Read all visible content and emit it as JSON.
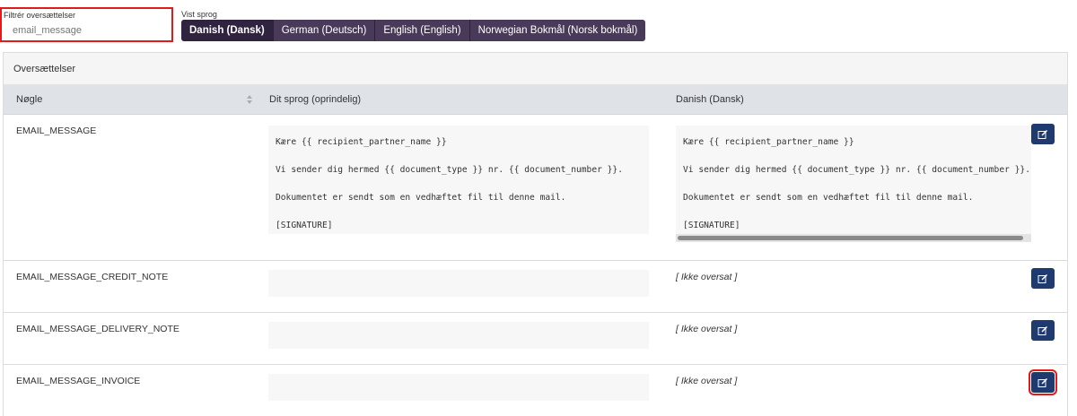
{
  "filter": {
    "label": "Filtrér oversættelser",
    "placeholder": "email_message"
  },
  "languages": {
    "label": "Vist sprog",
    "options": [
      "Danish (Dansk)",
      "German (Deutsch)",
      "English (English)",
      "Norwegian Bokmål (Norsk bokmål)"
    ],
    "active": "Danish (Dansk)"
  },
  "panel": {
    "title": "Oversættelser",
    "columns": [
      "Nøgle",
      "Dit sprog (oprindelig)",
      "Danish (Dansk)"
    ]
  },
  "rows": [
    {
      "key": "EMAIL_MESSAGE",
      "original": [
        "Kære {{ recipient_partner_name }}",
        "Vi sender dig hermed {{ document_type }} nr. {{ document_number }}.",
        "Dokumentet er sendt som en vedhæftet fil til denne mail.",
        "[SIGNATURE]"
      ],
      "translation": [
        "Kære {{ recipient_partner_name }}",
        "Vi sender dig hermed {{ document_type }} nr. {{ document_number }}.",
        "Dokumentet er sendt som en vedhæftet fil til denne mail.",
        "[SIGNATURE]"
      ]
    },
    {
      "key": "EMAIL_MESSAGE_CREDIT_NOTE",
      "translation_text": "[ Ikke oversat ]"
    },
    {
      "key": "EMAIL_MESSAGE_DELIVERY_NOTE",
      "translation_text": "[ Ikke oversat ]"
    },
    {
      "key": "EMAIL_MESSAGE_INVOICE",
      "translation_text": "[ Ikke oversat ]"
    }
  ],
  "colors": {
    "language_button": "#4a3a59",
    "language_button_active": "#2f2340",
    "edit_button": "#1e3a6e",
    "highlight": "#e01b1b",
    "header_bg": "#dfe3e8"
  },
  "icons": {
    "edit": "pencil-square-icon",
    "sort": "sort-icon"
  }
}
